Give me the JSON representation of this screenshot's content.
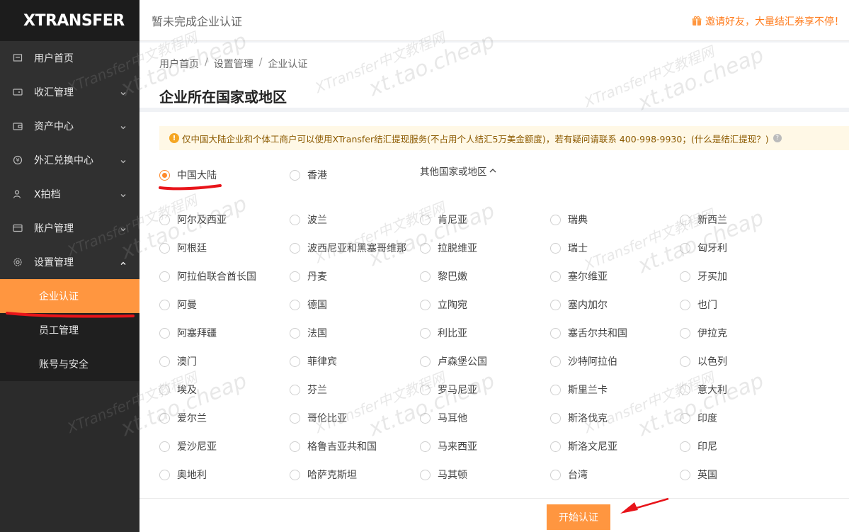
{
  "app": {
    "logo": "XTRANSFER"
  },
  "header": {
    "title": "暂未完成企业认证",
    "invite": "邀请好友，大量结汇券享不停！"
  },
  "sidebar": {
    "items": [
      {
        "label": "用户首页",
        "icon": "home-icon",
        "chevron": false
      },
      {
        "label": "收汇管理",
        "icon": "wallet-icon",
        "chevron": true
      },
      {
        "label": "资产中心",
        "icon": "briefcase-icon",
        "chevron": true
      },
      {
        "label": "外汇兑换中心",
        "icon": "exchange-icon",
        "chevron": true
      },
      {
        "label": "X拍档",
        "icon": "user-icon",
        "chevron": true
      },
      {
        "label": "账户管理",
        "icon": "card-icon",
        "chevron": true
      },
      {
        "label": "设置管理",
        "icon": "gear-icon",
        "chevron": true,
        "expanded": true
      }
    ],
    "subitems": [
      {
        "label": "企业认证",
        "active": true
      },
      {
        "label": "员工管理",
        "active": false
      },
      {
        "label": "账号与安全",
        "active": false
      }
    ]
  },
  "breadcrumb": [
    "用户首页",
    "设置管理",
    "企业认证"
  ],
  "page_title": "企业所在国家或地区",
  "notice": {
    "text": "仅中国大陆企业和个体工商户可以使用XTransfer结汇提现服务(不占用个人结汇5万美金额度)，若有疑问请联系 400-998-9930；(什么是结汇提现？)"
  },
  "primary_regions": [
    {
      "label": "中国大陆",
      "checked": true
    },
    {
      "label": "香港",
      "checked": false
    }
  ],
  "other_toggle": "其他国家或地区",
  "countries": [
    [
      "阿尔及西亚",
      "波兰",
      "肯尼亚",
      "瑞典",
      "新西兰"
    ],
    [
      "阿根廷",
      "波西尼亚和黑塞哥维那",
      "拉脱维亚",
      "瑞士",
      "匈牙利"
    ],
    [
      "阿拉伯联合酋长国",
      "丹麦",
      "黎巴嫩",
      "塞尔维亚",
      "牙买加"
    ],
    [
      "阿曼",
      "德国",
      "立陶宛",
      "塞内加尔",
      "也门"
    ],
    [
      "阿塞拜疆",
      "法国",
      "利比亚",
      "塞舌尔共和国",
      "伊拉克"
    ],
    [
      "澳门",
      "菲律宾",
      "卢森堡公国",
      "沙特阿拉伯",
      "以色列"
    ],
    [
      "埃及",
      "芬兰",
      "罗马尼亚",
      "斯里兰卡",
      "意大利"
    ],
    [
      "爱尔兰",
      "哥伦比亚",
      "马耳他",
      "斯洛伐克",
      "印度"
    ],
    [
      "爱沙尼亚",
      "格鲁吉亚共和国",
      "马来西亚",
      "斯洛文尼亚",
      "印尼"
    ],
    [
      "奥地利",
      "哈萨克斯坦",
      "马其顿",
      "台湾",
      "英国"
    ]
  ],
  "start_button": "开始认证",
  "watermark": {
    "line1": "XTransfer中文教程网",
    "line2": "xt.tao.cheap"
  },
  "colors": {
    "accent": "#ff9640",
    "annotation": "#e8141a"
  }
}
